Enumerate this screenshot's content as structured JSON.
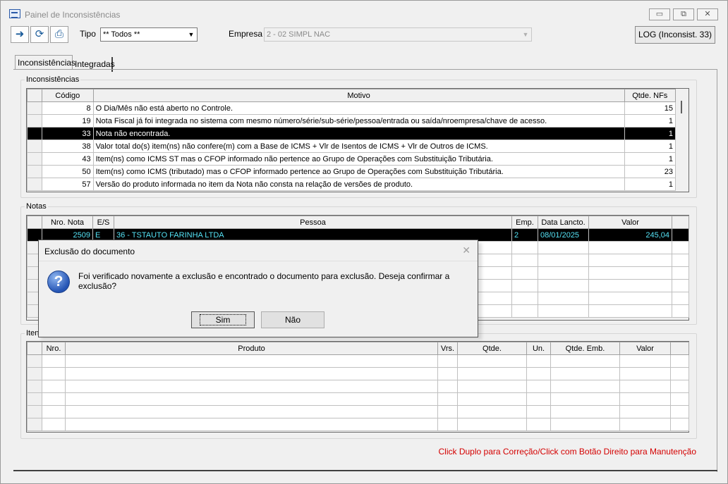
{
  "window": {
    "title": "Painel de Inconsistências"
  },
  "toolbar": {
    "tipo_label": "Tipo",
    "tipo_value": "** Todos **",
    "empresa_label": "Empresa",
    "empresa_value": "2 - 02 SIMPL NAC",
    "log_button": "LOG (Inconsist. 33)"
  },
  "tabs": [
    {
      "label": "Inconsistências",
      "active": true
    },
    {
      "label": "Integradas",
      "active": false
    }
  ],
  "inconsistencias": {
    "title": "Inconsistências",
    "columns": [
      "Código",
      "Motivo",
      "Qtde. NFs"
    ],
    "rows": [
      {
        "codigo": "8",
        "motivo": "O Dia/Mês não está aberto no Controle.",
        "qtde": "15",
        "selected": false
      },
      {
        "codigo": "19",
        "motivo": "Nota Fiscal já foi integrada no sistema com mesmo número/série/sub-série/pessoa/entrada ou saída/nroempresa/chave de acesso.",
        "qtde": "1",
        "selected": false
      },
      {
        "codigo": "33",
        "motivo": "Nota não encontrada.",
        "qtde": "1",
        "selected": true
      },
      {
        "codigo": "38",
        "motivo": "Valor total do(s) item(ns) não confere(m) com a Base de ICMS + Vlr de Isentos de ICMS + Vlr de Outros de ICMS.",
        "qtde": "1",
        "selected": false
      },
      {
        "codigo": "43",
        "motivo": "Item(ns) como ICMS ST mas o CFOP informado não pertence ao Grupo de Operações com Substituição Tributária.",
        "qtde": "1",
        "selected": false
      },
      {
        "codigo": "50",
        "motivo": "Item(ns) como ICMS (tributado) mas o CFOP informado pertence ao Grupo de Operações com Substituição Tributária.",
        "qtde": "23",
        "selected": false
      },
      {
        "codigo": "57",
        "motivo": "Versão do produto informada no item da Nota não consta na relação de versões de produto.",
        "qtde": "1",
        "selected": false
      }
    ]
  },
  "notas": {
    "title": "Notas",
    "columns": [
      "Nro. Nota",
      "E/S",
      "Pessoa",
      "Emp.",
      "Data Lancto.",
      "Valor"
    ],
    "rows": [
      {
        "nro": "2509",
        "es": "E",
        "pessoa": "36 - TSTAUTO FARINHA LTDA",
        "emp": "2",
        "data": "08/01/2025",
        "valor": "245,04"
      }
    ]
  },
  "itens": {
    "title": "Itens",
    "columns": [
      "Nro.",
      "Produto",
      "Vrs.",
      "Qtde.",
      "Un.",
      "Qtde. Emb.",
      "Valor"
    ]
  },
  "footer_note": "Click Duplo para Correção/Click com Botão Direito para Manutenção",
  "dialog": {
    "title": "Exclusão do documento",
    "message": "Foi verificado novamente a exclusão e encontrado o documento para exclusão. Deseja confirmar a exclusão?",
    "yes": "Sim",
    "no": "Não"
  }
}
